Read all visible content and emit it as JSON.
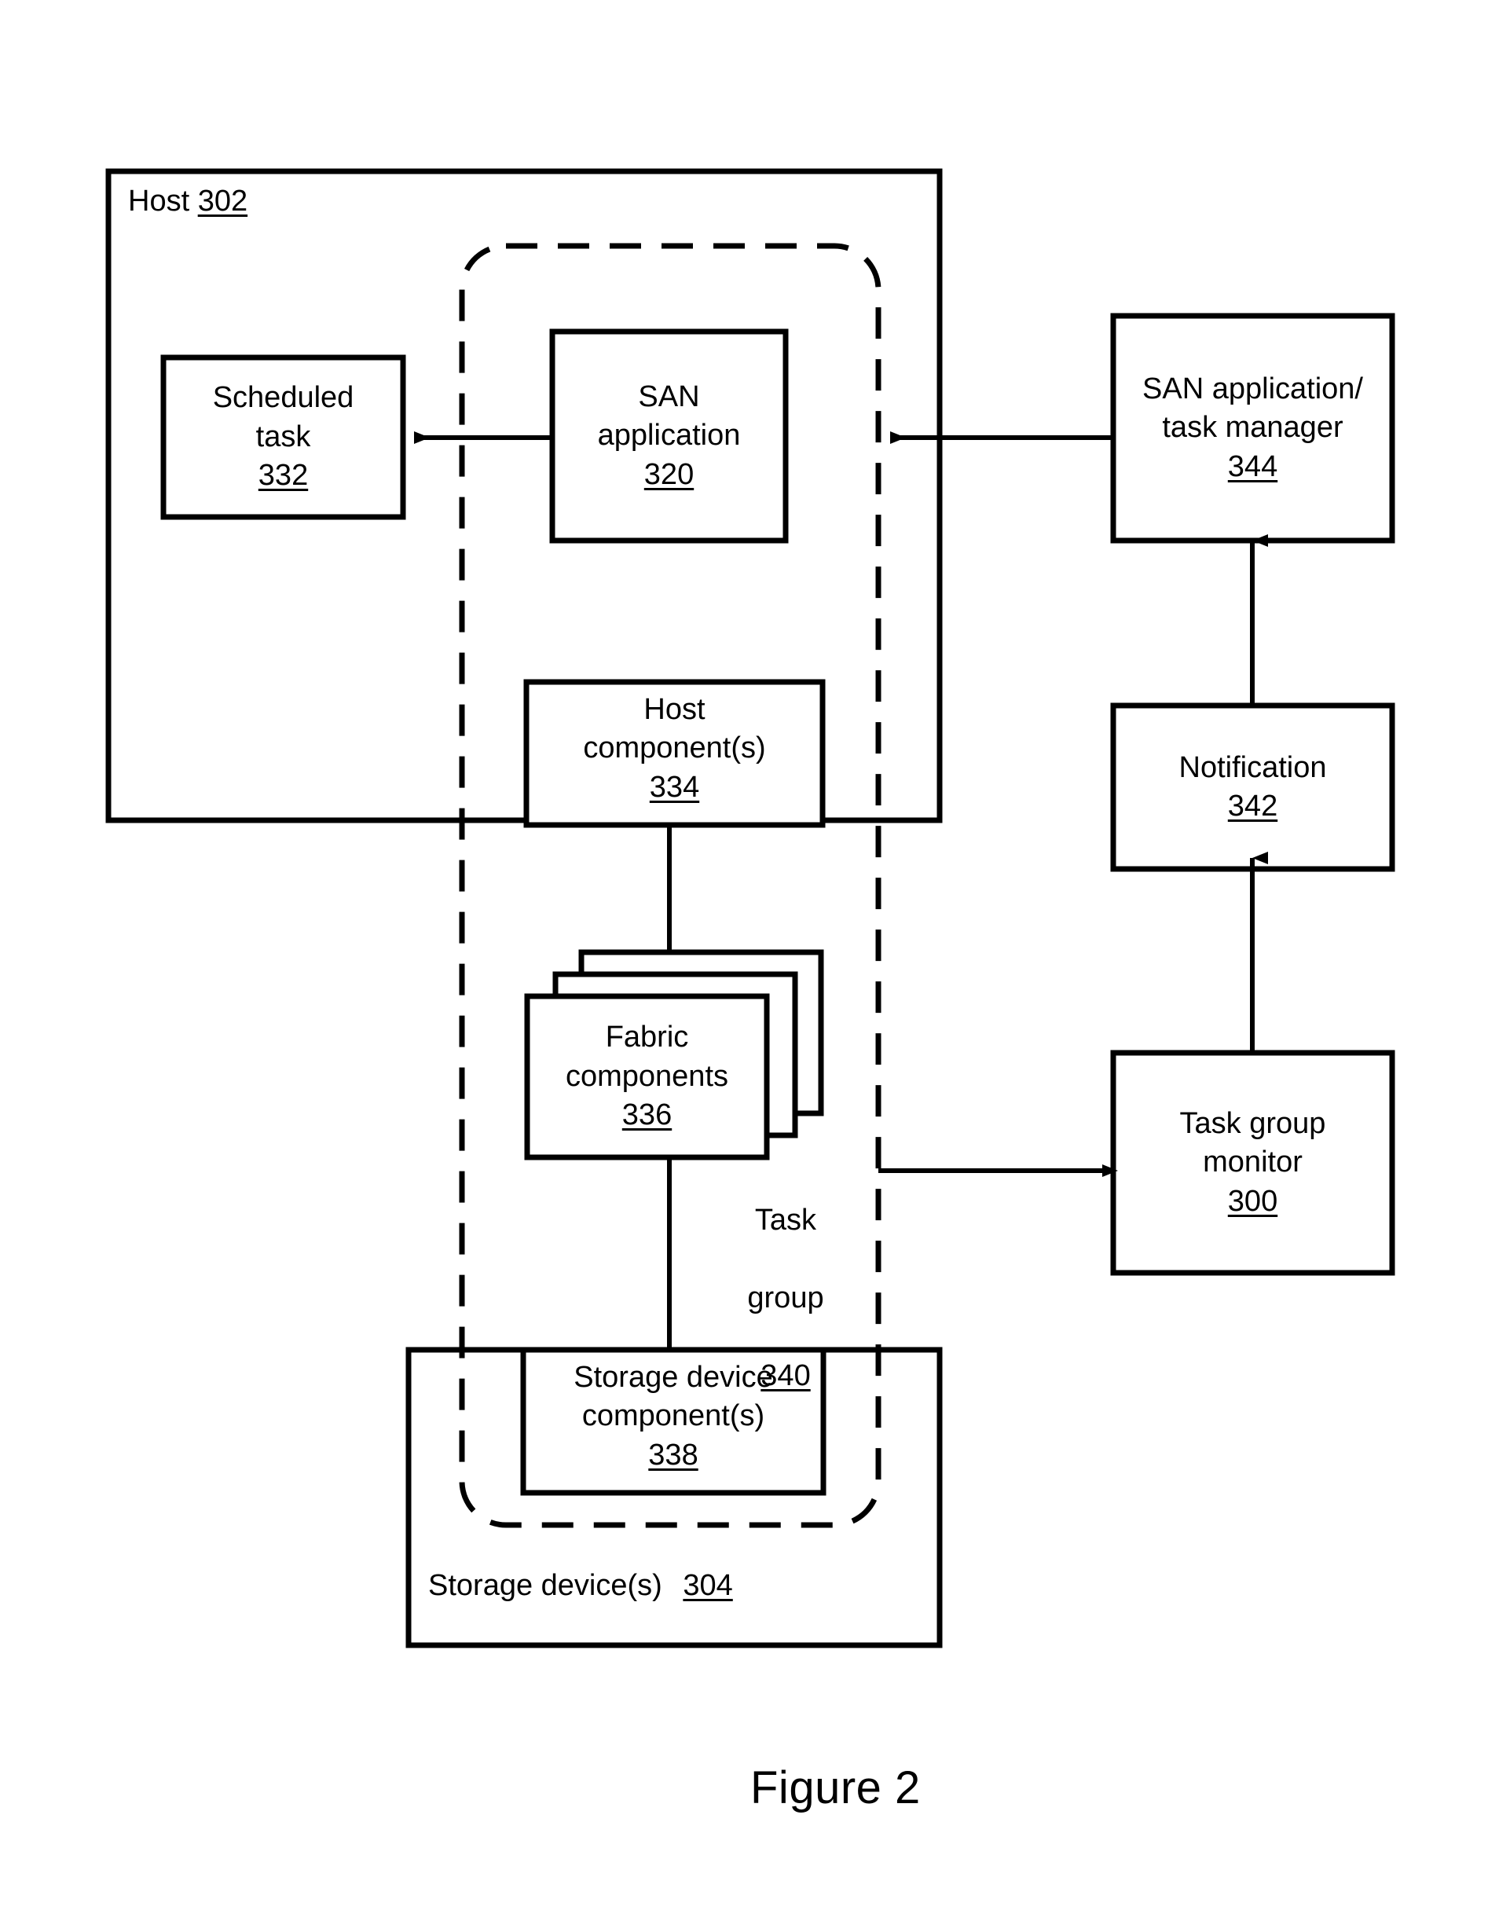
{
  "figure": {
    "caption": "Figure 2",
    "title_text": "Figure 2"
  },
  "containers": {
    "host": {
      "label": "Host",
      "ref": "302"
    },
    "storage_devices": {
      "label": "Storage device(s)",
      "ref": "304"
    },
    "task_group": {
      "label_line1": "Task",
      "label_line2": "group",
      "ref": "340",
      "style": "dashed-rounded-rectangle"
    }
  },
  "boxes": [
    {
      "id": "scheduled-task",
      "lines": [
        "Scheduled",
        "task"
      ],
      "ref": "332"
    },
    {
      "id": "san-application",
      "lines": [
        "SAN",
        "application"
      ],
      "ref": "320"
    },
    {
      "id": "san-application-task-manager",
      "lines": [
        "SAN application/",
        "task manager"
      ],
      "ref": "344"
    },
    {
      "id": "host-components",
      "lines": [
        "Host",
        "component(s)"
      ],
      "ref": "334"
    },
    {
      "id": "fabric-components",
      "lines": [
        "Fabric",
        "components"
      ],
      "ref": "336",
      "stacked": "true"
    },
    {
      "id": "storage-device-components",
      "lines": [
        "Storage device",
        "component(s)"
      ],
      "ref": "338"
    },
    {
      "id": "notification",
      "lines": [
        "Notification"
      ],
      "ref": "342"
    },
    {
      "id": "task-group-monitor",
      "lines": [
        "Task group",
        "monitor"
      ],
      "ref": "300"
    }
  ],
  "connectors": [
    {
      "id": "san-app-to-scheduled-task",
      "direction": "left",
      "arrow": "true"
    },
    {
      "id": "task-manager-to-task-group",
      "direction": "left",
      "arrow": "true"
    },
    {
      "id": "task-group-to-monitor",
      "direction": "right",
      "arrow": "true"
    },
    {
      "id": "monitor-to-notification",
      "direction": "up",
      "arrow": "true"
    },
    {
      "id": "notification-to-task-manager",
      "direction": "up",
      "arrow": "true"
    },
    {
      "id": "host-components-to-fabric",
      "direction": "none",
      "arrow": "false"
    },
    {
      "id": "fabric-to-storage-components",
      "direction": "none",
      "arrow": "false"
    }
  ],
  "colors": {
    "stroke": "#000000",
    "background": "#ffffff"
  }
}
